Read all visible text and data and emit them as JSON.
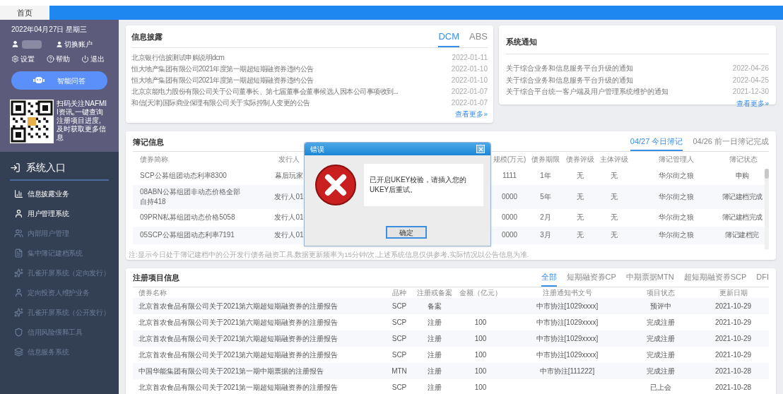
{
  "top_tabs": [
    {
      "label": "首页",
      "selected": true
    }
  ],
  "sidebar": {
    "date": "2022年04月27日 星期三",
    "switch_account": "切换账户",
    "actions": [
      {
        "kind": "settings",
        "label": "设置"
      },
      {
        "kind": "help",
        "label": "帮助"
      },
      {
        "kind": "logout",
        "label": "退出"
      }
    ],
    "assistant_button": "智能问答",
    "qr_text": "扫码关注NAFMII资讯,一键查询注册项目进度,及时获取更多信息",
    "section_title": "系统入口",
    "items": [
      {
        "kind": "chart",
        "label": "信息披露业务",
        "disabled": false
      },
      {
        "kind": "user",
        "label": "用户管理系统",
        "disabled": false
      },
      {
        "kind": "users",
        "label": "内部用户管理",
        "disabled": true
      },
      {
        "kind": "doc",
        "label": "集中簿记建档系统",
        "disabled": true
      },
      {
        "kind": "peacock",
        "label": "孔雀开屏系统（定向发行）",
        "disabled": true
      },
      {
        "kind": "user",
        "label": "定向投资人维护业务",
        "disabled": true
      },
      {
        "kind": "peacock",
        "label": "孔雀开屏系统（公开发行）",
        "disabled": true
      },
      {
        "kind": "shield",
        "label": "信用风险缓释工具",
        "disabled": true
      },
      {
        "kind": "layers",
        "label": "信息服务系统",
        "disabled": true
      }
    ]
  },
  "disclosure": {
    "title": "信息披露",
    "tabs": [
      {
        "label": "DCM",
        "selected": true
      },
      {
        "label": "ABS",
        "selected": false
      }
    ],
    "rows": [
      {
        "title": "北京银行信披测试申购说明dcm",
        "date": "2022-01-11"
      },
      {
        "title": "恒大地产集团有限公司2021年度第一期超短期融资券违约公告",
        "date": "2022-01-10"
      },
      {
        "title": "恒大地产集团有限公司2021年度第一期超短期融资券违约公告",
        "date": "2022-01-10"
      },
      {
        "title": "北京京能电力股份有限公司关于公司董事长、第七届董事会董事候选人因本公司事项收到...",
        "date": "2022-01-07"
      },
      {
        "title": "和信(天津)国际商业保理有限公司关于实际控制人变更的公告",
        "date": "2022-01-07"
      }
    ],
    "more": "查看更多»"
  },
  "notices": {
    "title": "系统通知",
    "rows": [
      {
        "title": "关于综合业务和信息服务平台升级的通知",
        "date": "2022-04-26"
      },
      {
        "title": "关于综合业务和信息服务平台升级的通知",
        "date": "2022-04-25"
      },
      {
        "title": "关于综合平台统一客户端及用户管理系统维护的通知",
        "date": "2021-12-30"
      }
    ],
    "more": "查看更多»"
  },
  "bookkeeping": {
    "title": "簿记信息",
    "tabs": [
      {
        "label": "04/27 今日簿记",
        "selected": true
      },
      {
        "label": "04/26 前一日簿记完成",
        "selected": false
      }
    ],
    "columns": [
      "债券简称",
      "发行人",
      "",
      "规模(万元)",
      "债券期限",
      "债券评级",
      "主体评级",
      "簿记管理人",
      "簿记状态"
    ],
    "rows": [
      [
        "SCP公募组团动态利率8300",
        "幕后玩家",
        "",
        "1111",
        "1年",
        "无",
        "无",
        "华尔街之狼",
        "申购"
      ],
      [
        "08ABN公募组团非动态价格全部自持418",
        "发行人01",
        "",
        "0000",
        "5年",
        "无",
        "无",
        "华尔街之狼",
        "簿记建档完成"
      ],
      [
        "09PRN私募组团动态价格5058",
        "发行人01",
        "",
        "0000",
        "2月",
        "无",
        "无",
        "华尔街之狼",
        "簿记建档完成"
      ],
      [
        "05SCP公募组团动态利率7191",
        "发行人01",
        "",
        "0000",
        "3月",
        "无",
        "无",
        "华尔街之狼",
        "簿记建档完"
      ]
    ],
    "note": "注:显示今日处于簿记建档中的公开发行债务融资工具,数据更新频率为15分钟/次,上述系统信息仅供参考,实际情况以公告信息为准."
  },
  "dialog": {
    "title": "错误",
    "message": "已开启UKEY校验，请插入您的UKEY后重试。",
    "button": "确定"
  },
  "registration": {
    "title": "注册项目信息",
    "tabs": [
      {
        "label": "全部",
        "selected": true
      },
      {
        "label": "短期融资券CP",
        "selected": false
      },
      {
        "label": "中期票据MTN",
        "selected": false
      },
      {
        "label": "超短期融资券SCP",
        "selected": false
      },
      {
        "label": "DFI",
        "selected": false
      }
    ],
    "columns": [
      "债券名称",
      "品种",
      "注册或备案",
      "金额（亿元）",
      "注册通知书文号",
      "项目状态",
      "更新日期"
    ],
    "rows": [
      [
        "北京首农食品有限公司关于2021第六期超短期融资券的注册报告",
        "SCP",
        "备案",
        "",
        "中市协注[1029xxxx]",
        "预评中",
        "2021-10-29"
      ],
      [
        "北京首农食品有限公司关于2021第六期超短期融资券的注册报告",
        "SCP",
        "注册",
        "100",
        "中市协注[1029xxxx]",
        "完成注册",
        "2021-10-29"
      ],
      [
        "北京首农食品有限公司关于2021第六期超短期融资券的注册报告",
        "SCP",
        "注册",
        "100",
        "中市协注[1029xxxx]",
        "完成注册",
        "2021-10-29"
      ],
      [
        "北京首农食品有限公司关于2021第六期超短期融资券的注册报告",
        "SCP",
        "注册",
        "100",
        "中市协注[1029xxxx]",
        "完成注册",
        "2021-10-29"
      ],
      [
        "中国华能集团有限公司关于2021第一期中期票据的注册报告",
        "MTN",
        "注册",
        "100",
        "中市协注[111222]",
        "完成注册",
        "2021-10-28"
      ],
      [
        "北京首农食品有限公司关于2021第一期超短期融资券的注册报告",
        "SCP",
        "注册",
        "100",
        "",
        "已上会",
        "2021-10-28"
      ]
    ]
  }
}
